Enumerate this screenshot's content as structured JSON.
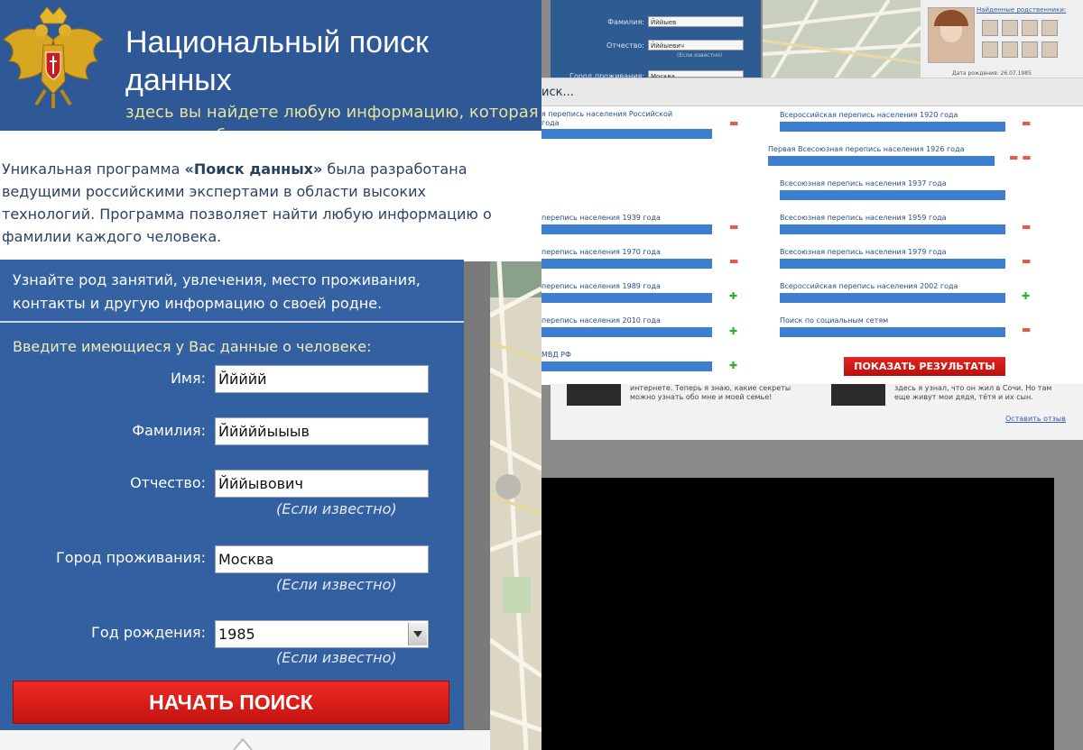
{
  "background_form": {
    "surname_label": "Фамилия:",
    "surname_value": "Йййыев",
    "patronymic_label": "Отчество:",
    "patronymic_value": "Йййыевич",
    "hint": "(Если известно)",
    "city_label": "Город проживания:",
    "city_value": "Москва"
  },
  "background_profile": {
    "relatives_link": "Найденные родственники:",
    "birth_date": "Дата рождения: 26.07.1985"
  },
  "popup": {
    "title": "иск...",
    "show_results_button": "ПОКАЗАТЬ РЕЗУЛЬТАТЫ",
    "left_rows": [
      {
        "label": "я перепись населения Российской",
        "label2": "года",
        "status": "minus"
      },
      {
        "label": "перепись населения 1939 года",
        "status": "minus"
      },
      {
        "label": "перепись населения 1970 года",
        "status": "minus"
      },
      {
        "label": "перепись населения 1989 года",
        "status": "plus"
      },
      {
        "label": "перепись населения 2010 года",
        "status": "plus"
      },
      {
        "label": "МВД РФ",
        "status": "plus"
      }
    ],
    "right_rows": [
      {
        "label": "Всероссийская перепись населения 1920 года",
        "status": "minus"
      },
      {
        "label": "Первая Всесоюзная перепись населения 1926 года",
        "status": "minus-minus"
      },
      {
        "label": "Всесоюзная перепись населения 1937 года",
        "status": "none"
      },
      {
        "label": "Всесоюзная перепись населения 1959 года",
        "status": "minus"
      },
      {
        "label": "Всесоюзная перепись населения 1979 года",
        "status": "minus"
      },
      {
        "label": "Всероссийская перепись населения 2002 года",
        "status": "plus"
      },
      {
        "label": "Поиск по социальным сетям",
        "status": "minus"
      }
    ]
  },
  "testimonials": {
    "left_text": "интернете. Теперь я знаю, какие секреты можно узнать обо мне и моей семье!",
    "right_text": "здесь я узнал, что он жил в Сочи. Но там еще живут мои дядя, тётя и их сын.",
    "leave_review": "Оставить отзыв"
  },
  "header": {
    "title": "Национальный поиск данных",
    "subtitle": "здесь вы найдете любую информацию, которая х архивах и базах данных сети"
  },
  "intro": {
    "part1": "Уникальная программа ",
    "program_name": "«Поиск данных»",
    "part2": " была разработана ведущими российскими экспертами в области высоких технологий. Программа позволяет найти любую информацию о фамилии каждого человека."
  },
  "form": {
    "top_text": "Узнайте род занятий, увлечения, место проживания, контакты и другую информацию о своей родне.",
    "prompt": "Введите имеющиеся у Вас данные о человеке:",
    "name_label": "Имя:",
    "name_value": "Ййййй",
    "surname_label": "Фамилия:",
    "surname_value": "Йййййыыыв",
    "patronymic_label": "Отчество:",
    "patronymic_value": "Йййывович",
    "hint": "(Если известно)",
    "city_label": "Город проживания:",
    "city_value": "Москва",
    "year_label": "Год рождения:",
    "year_value": "1985",
    "search_button": "НАЧАТЬ ПОИСК"
  },
  "colors": {
    "panel_blue": "#3260a0",
    "bar_blue": "#3d7ed0",
    "button_red": "#d91c17",
    "minus_red": "#e35a4a",
    "plus_green": "#2cae2c"
  }
}
